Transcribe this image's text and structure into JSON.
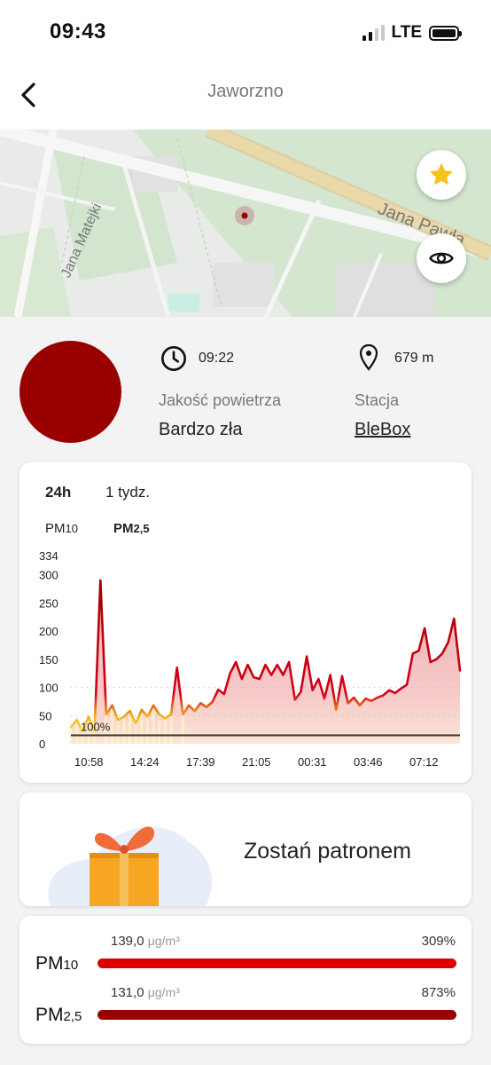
{
  "status_bar": {
    "time": "09:43",
    "network": "LTE"
  },
  "nav": {
    "title": "Jaworzno"
  },
  "map": {
    "street_1": "Jana Matejki",
    "street_2": "Jana Pawła"
  },
  "station": {
    "measurement_time": "09:22",
    "distance": "679 m",
    "quality_label": "Jakość powietrza",
    "quality_value": "Bardzo zła",
    "station_label": "Stacja",
    "station_value": "BleBox",
    "quality_color": "#990000"
  },
  "chart_card": {
    "range_tabs": [
      "24h",
      "1 tydz."
    ],
    "active_range": "24h",
    "pollutant_tabs": [
      {
        "main": "PM",
        "sub": "10"
      },
      {
        "main": "PM",
        "sub": "2,5"
      }
    ],
    "active_pollutant": "PM2,5"
  },
  "chart_data": {
    "type": "area",
    "series_name": "PM2,5",
    "x_tick_labels": [
      "10:58",
      "14:24",
      "17:39",
      "21:05",
      "00:31",
      "03:46",
      "07:12"
    ],
    "y_tick_labels": [
      "334",
      "300",
      "250",
      "200",
      "150",
      "100",
      "50",
      "0"
    ],
    "ylim": [
      0,
      334
    ],
    "norm_value": 15,
    "norm_label": "100%",
    "values": [
      30,
      42,
      22,
      48,
      22,
      290,
      52,
      68,
      42,
      48,
      58,
      36,
      60,
      48,
      68,
      52,
      45,
      52,
      135,
      52,
      68,
      58,
      72,
      65,
      74,
      96,
      88,
      125,
      145,
      115,
      140,
      118,
      115,
      140,
      122,
      140,
      122,
      145,
      78,
      92,
      155,
      95,
      115,
      80,
      122,
      60,
      120,
      72,
      82,
      68,
      80,
      76,
      82,
      86,
      95,
      90,
      98,
      105,
      160,
      165,
      205,
      145,
      150,
      160,
      180,
      222,
      130
    ],
    "colors": {
      "line": "#c8102e",
      "fill": "#f3b5b5",
      "low": "#f7df3c",
      "norm": "#333333"
    }
  },
  "promo": {
    "text": "Zostań patronem"
  },
  "pollutants": [
    {
      "main": "PM",
      "sub": "10",
      "value": "139,0",
      "unit": "μg/m³",
      "percent": "309%",
      "color": "#dd0000"
    },
    {
      "main": "PM",
      "sub": "2,5",
      "value": "131,0",
      "unit": "μg/m³",
      "percent": "873%",
      "color": "#990000"
    }
  ]
}
